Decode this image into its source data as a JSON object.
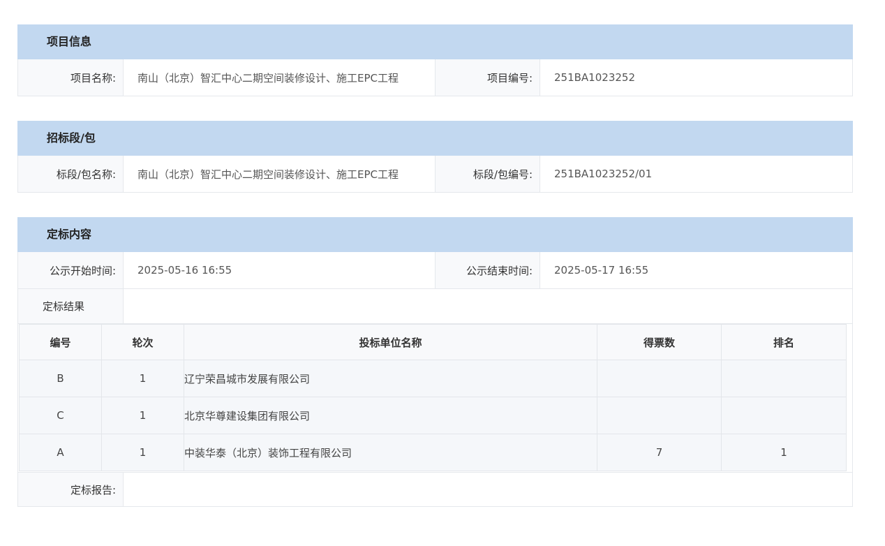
{
  "project_info": {
    "header": "项目信息",
    "name_label": "项目名称:",
    "name_value": "南山（北京）智汇中心二期空间装修设计、施工EPC工程",
    "code_label": "项目编号:",
    "code_value": "251BA1023252"
  },
  "bid_section": {
    "header": "招标段/包",
    "name_label": "标段/包名称:",
    "name_value": "南山（北京）智汇中心二期空间装修设计、施工EPC工程",
    "code_label": "标段/包编号:",
    "code_value": "251BA1023252/01"
  },
  "award": {
    "header": "定标内容",
    "start_label": "公示开始时间:",
    "start_value": "2025-05-16 16:55",
    "end_label": "公示结束时间:",
    "end_value": "2025-05-17 16:55",
    "result_label": "定标结果",
    "report_label": "定标报告:",
    "columns": [
      "编号",
      "轮次",
      "投标单位名称",
      "得票数",
      "排名"
    ],
    "rows": [
      {
        "code": "B",
        "round": "1",
        "company": "辽宁荣昌城市发展有限公司",
        "votes": "",
        "rank": ""
      },
      {
        "code": "C",
        "round": "1",
        "company": "北京华尊建设集团有限公司",
        "votes": "",
        "rank": ""
      },
      {
        "code": "A",
        "round": "1",
        "company": "中装华泰（北京）装饰工程有限公司",
        "votes": "7",
        "rank": "1"
      }
    ]
  }
}
